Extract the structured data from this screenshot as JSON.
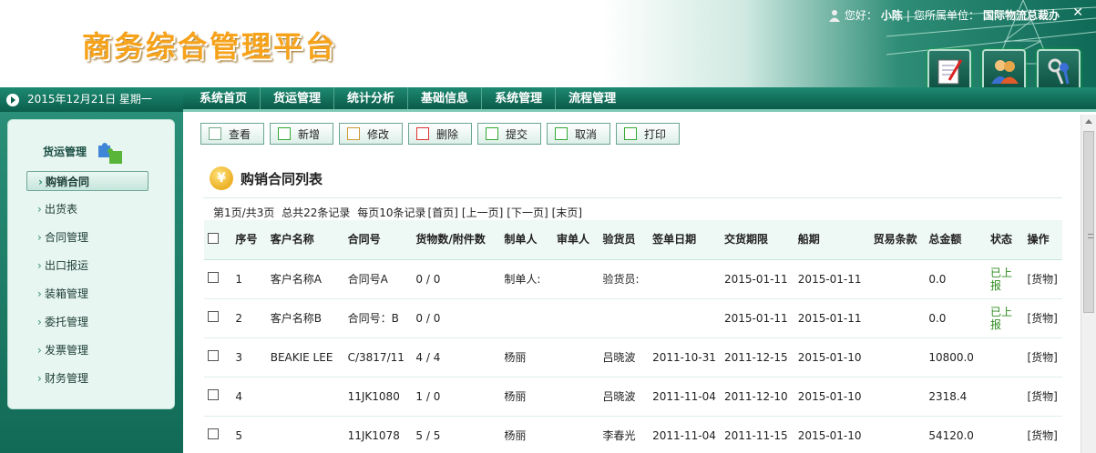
{
  "header": {
    "logo": "商务综合管理平台",
    "greeting": "您好：",
    "username": "小陈",
    "separator": "|",
    "unit_label": "您所属单位：",
    "unit": "国际物流总裁办"
  },
  "datebar": {
    "date": "2015年12月21日 星期一"
  },
  "nav": {
    "items": [
      "系统首页",
      "货运管理",
      "统计分析",
      "基础信息",
      "系统管理",
      "流程管理"
    ]
  },
  "sidebar": {
    "section": "货运管理",
    "items": [
      "购销合同",
      "出货表",
      "合同管理",
      "出口报运",
      "装箱管理",
      "委托管理",
      "发票管理",
      "财务管理"
    ]
  },
  "toolbar": {
    "buttons": [
      "查看",
      "新增",
      "修改",
      "删除",
      "提交",
      "取消",
      "打印"
    ]
  },
  "list": {
    "title": "购销合同列表",
    "pager": [
      "第1页",
      "/",
      "共3页",
      "总共22条记录",
      "每页10条记录",
      "[首页]",
      "[上一页]",
      "[下一页]",
      "[末页]"
    ],
    "columns": [
      "序号",
      "客户名称",
      "合同号",
      "货物数/附件数",
      "制单人",
      "审单人",
      "验货员",
      "签单日期",
      "交货期限",
      "船期",
      "贸易条款",
      "总金额",
      "状态",
      "操作"
    ],
    "rows": [
      [
        "1",
        "客户名称A",
        "合同号A",
        "0 / 0",
        "制单人:",
        "",
        "验货员:",
        "",
        "2015-01-11",
        "2015-01-11",
        "",
        "0.0",
        "已上报",
        "[货物]"
      ],
      [
        "2",
        "客户名称B",
        "合同号：B",
        "0 / 0",
        "",
        "",
        "",
        "",
        "2015-01-11",
        "2015-01-11",
        "",
        "0.0",
        "已上报",
        "[货物]"
      ],
      [
        "3",
        "BEAKIE LEE",
        "C/3817/11",
        "4 / 4",
        "杨丽",
        "",
        "吕晓波",
        "2011-10-31",
        "2011-12-15",
        "2015-01-10",
        "",
        "10800.0",
        "",
        "[货物]"
      ],
      [
        "4",
        "",
        "11JK1080",
        "1 / 0",
        "杨丽",
        "",
        "吕晓波",
        "2011-11-04",
        "2011-12-10",
        "2015-01-10",
        "",
        "2318.4",
        "",
        "[货物]"
      ],
      [
        "5",
        "",
        "11JK1078",
        "5 / 5",
        "杨丽",
        "",
        "李春光",
        "2011-11-04",
        "2011-11-15",
        "2015-01-10",
        "",
        "54120.0",
        "",
        "[货物]"
      ]
    ]
  },
  "colors": {
    "brand_green": "#0b5e4c",
    "status_green": "#2e8b1e"
  }
}
